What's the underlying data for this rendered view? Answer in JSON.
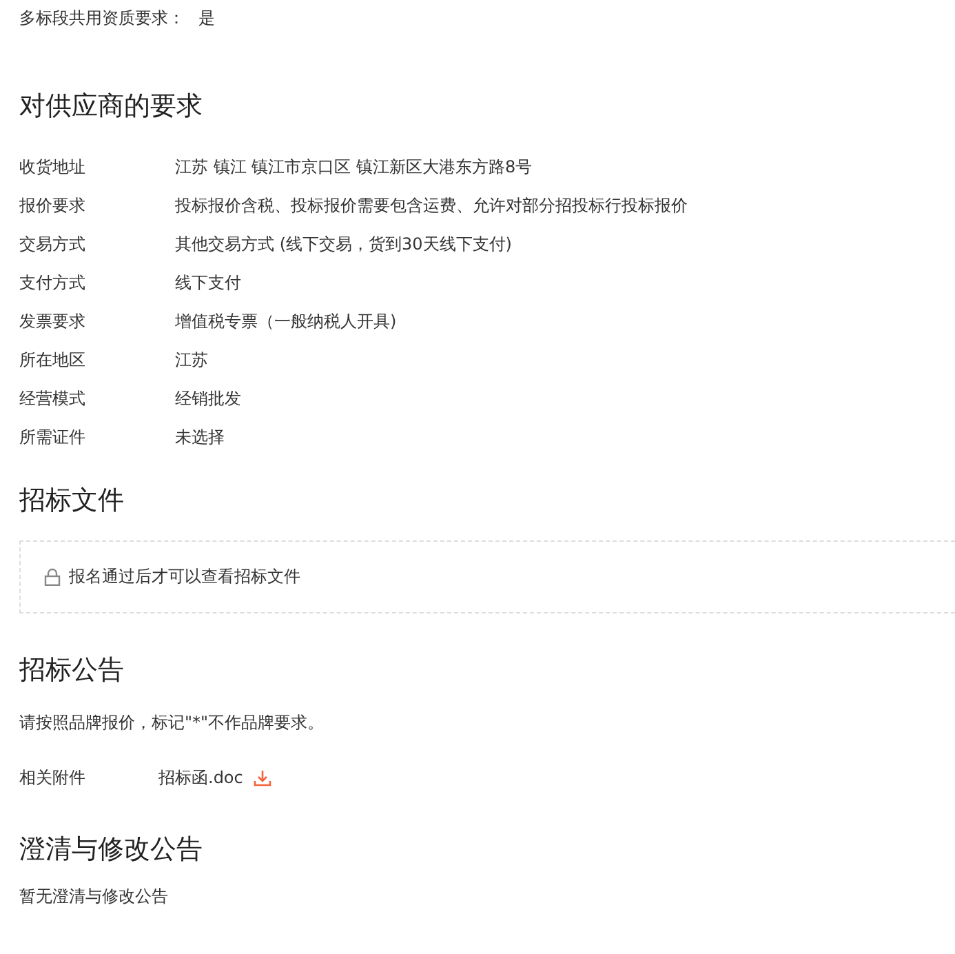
{
  "shared_qualification": {
    "label": "多标段共用资质要求：",
    "value": "是"
  },
  "supplier_requirements": {
    "title": "对供应商的要求",
    "rows": [
      {
        "label": "收货地址",
        "value": "江苏 镇江 镇江市京口区 镇江新区大港东方路8号"
      },
      {
        "label": "报价要求",
        "value": "投标报价含税、投标报价需要包含运费、允许对部分招投标行投标报价"
      },
      {
        "label": "交易方式",
        "value": "其他交易方式 (线下交易，货到30天线下支付)"
      },
      {
        "label": "支付方式",
        "value": "线下支付"
      },
      {
        "label": "发票要求",
        "value": "增值税专票（一般纳税人开具)"
      },
      {
        "label": "所在地区",
        "value": "江苏"
      },
      {
        "label": "经营模式",
        "value": "经销批发"
      },
      {
        "label": "所需证件",
        "value": "未选择"
      }
    ]
  },
  "tender_documents": {
    "title": "招标文件",
    "locked_notice": "报名通过后才可以查看招标文件"
  },
  "tender_announcement": {
    "title": "招标公告",
    "text": "请按照品牌报价，标记\"*\"不作品牌要求。",
    "attachment": {
      "label": "相关附件",
      "file": "招标函.doc"
    }
  },
  "clarification": {
    "title": "澄清与修改公告",
    "text": "暂无澄清与修改公告"
  }
}
